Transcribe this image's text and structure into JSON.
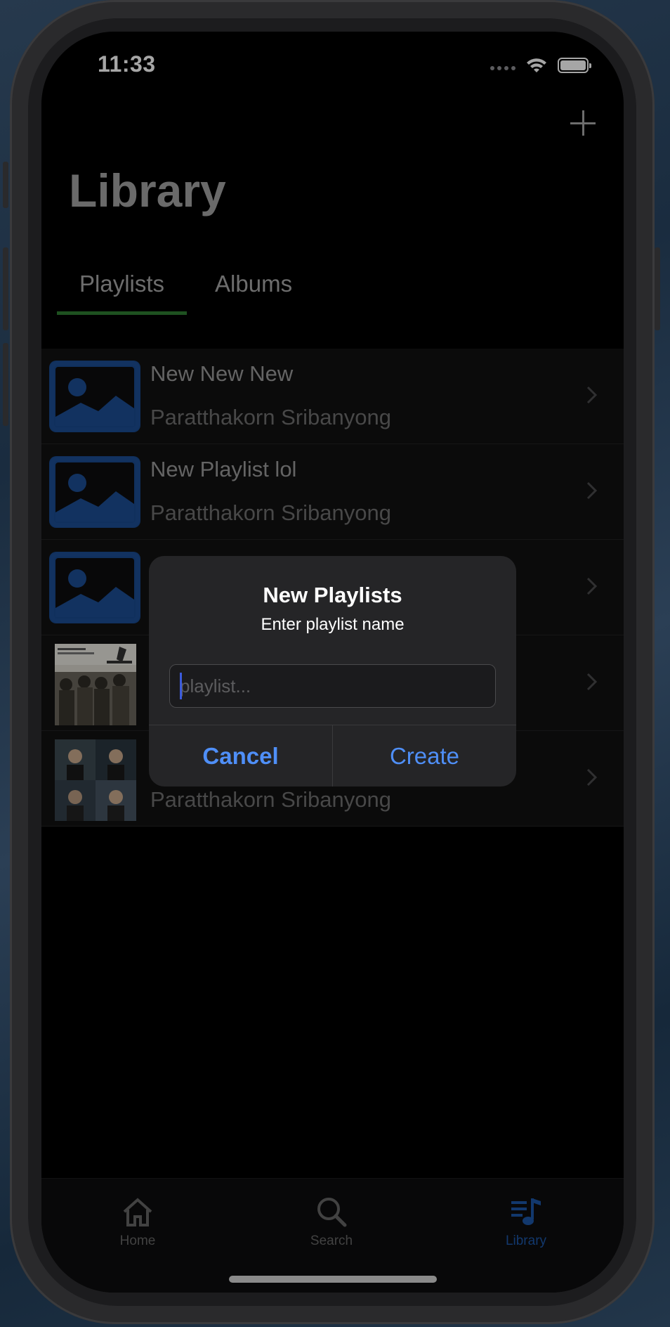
{
  "status_bar": {
    "time": "11:33"
  },
  "header": {
    "title": "Library",
    "add_icon": "plus-icon"
  },
  "tabs": [
    {
      "label": "Playlists",
      "active": true
    },
    {
      "label": "Albums",
      "active": false
    }
  ],
  "playlists": [
    {
      "title": "New New New",
      "owner": "Paratthakorn Sribanyong",
      "thumbnail": "image-placeholder-icon"
    },
    {
      "title": "New Playlist lol",
      "owner": "Paratthakorn Sribanyong",
      "thumbnail": "image-placeholder-icon"
    },
    {
      "title": "",
      "owner": "",
      "thumbnail": "image-placeholder-icon"
    },
    {
      "title": "",
      "owner": "",
      "thumbnail": "album-cover-photo"
    },
    {
      "title": "",
      "owner": "Paratthakorn Sribanyong",
      "thumbnail": "album-cover-photo"
    }
  ],
  "alert": {
    "title": "New Playlists",
    "message": "Enter playlist name",
    "input_value": "",
    "input_placeholder": "playlist...",
    "cancel_label": "Cancel",
    "create_label": "Create"
  },
  "tab_bar": {
    "items": [
      {
        "label": "Home",
        "icon": "home-icon",
        "active": false
      },
      {
        "label": "Search",
        "icon": "search-icon",
        "active": false
      },
      {
        "label": "Library",
        "icon": "library-music-icon",
        "active": true
      }
    ]
  },
  "colors": {
    "accent_blue": "#4f8ff7",
    "tab_underline_green": "#2e7d32",
    "active_tab_blue": "#1d57a8",
    "placeholder_blue": "#1a4b8f"
  }
}
